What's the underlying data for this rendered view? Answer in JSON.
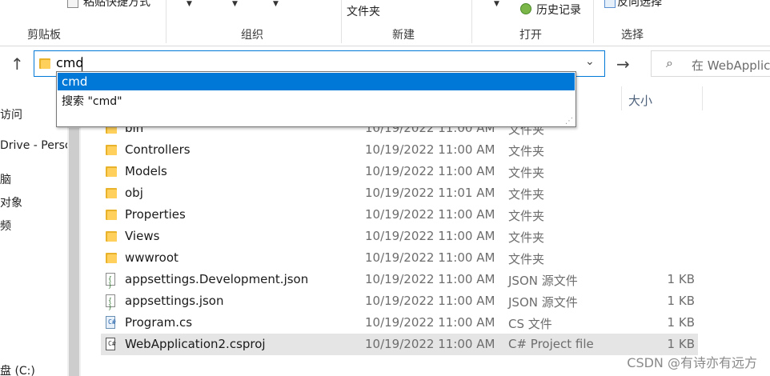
{
  "ribbon": {
    "paste_shortcut": "粘贴快捷方式",
    "folder_label": "文件夹",
    "history": "历史记录",
    "invert_select": "反向选择",
    "groups": [
      "剪贴板",
      "组织",
      "新建",
      "打开",
      "选择"
    ]
  },
  "address": {
    "value": "cmd"
  },
  "search": {
    "placeholder": "在 WebApplic"
  },
  "suggestions": [
    "cmd",
    "搜索 \"cmd\""
  ],
  "columns": {
    "size": "大小"
  },
  "nav": [
    "访问",
    "Drive - Persc",
    "脑",
    "对象",
    "频",
    "",
    "",
    "",
    "",
    "盘 (C:)"
  ],
  "files": [
    {
      "name": "bin",
      "date": "10/19/2022 11:00 AM",
      "type": "文件夹",
      "size": "",
      "icon": "folder-icon"
    },
    {
      "name": "Controllers",
      "date": "10/19/2022 11:00 AM",
      "type": "文件夹",
      "size": "",
      "icon": "folder-icon"
    },
    {
      "name": "Models",
      "date": "10/19/2022 11:00 AM",
      "type": "文件夹",
      "size": "",
      "icon": "folder-icon"
    },
    {
      "name": "obj",
      "date": "10/19/2022 11:01 AM",
      "type": "文件夹",
      "size": "",
      "icon": "folder-icon"
    },
    {
      "name": "Properties",
      "date": "10/19/2022 11:00 AM",
      "type": "文件夹",
      "size": "",
      "icon": "folder-icon"
    },
    {
      "name": "Views",
      "date": "10/19/2022 11:00 AM",
      "type": "文件夹",
      "size": "",
      "icon": "folder-icon"
    },
    {
      "name": "wwwroot",
      "date": "10/19/2022 11:00 AM",
      "type": "文件夹",
      "size": "",
      "icon": "folder-icon"
    },
    {
      "name": "appsettings.Development.json",
      "date": "10/19/2022 11:00 AM",
      "type": "JSON 源文件",
      "size": "1 KB",
      "icon": "json-file-icon"
    },
    {
      "name": "appsettings.json",
      "date": "10/19/2022 11:00 AM",
      "type": "JSON 源文件",
      "size": "1 KB",
      "icon": "json-file-icon"
    },
    {
      "name": "Program.cs",
      "date": "10/19/2022 11:00 AM",
      "type": "CS 文件",
      "size": "1 KB",
      "icon": "cs-file-icon"
    },
    {
      "name": "WebApplication2.csproj",
      "date": "10/19/2022 11:00 AM",
      "type": "C# Project file",
      "size": "1 KB",
      "icon": "csproj-file-icon"
    }
  ],
  "watermark": "CSDN @有诗亦有远方",
  "colors": {
    "accent": "#0078d7",
    "selected_row": "#cce8ff",
    "folder": "#ffd15c"
  }
}
